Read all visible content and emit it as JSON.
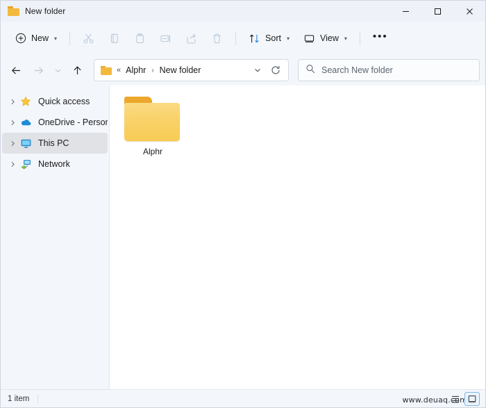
{
  "window": {
    "title": "New folder",
    "title_icon": "folder-icon",
    "controls": {
      "minimize": "minimize-icon",
      "maximize": "maximize-icon",
      "close": "close-icon"
    }
  },
  "toolbar": {
    "new_label": "New",
    "new_icon": "plus-circle-icon",
    "items": [
      {
        "name": "cut",
        "icon": "scissors-icon",
        "disabled": true
      },
      {
        "name": "copy",
        "icon": "copy-icon",
        "disabled": true
      },
      {
        "name": "paste",
        "icon": "clipboard-icon",
        "disabled": true
      },
      {
        "name": "rename",
        "icon": "rename-icon",
        "disabled": true
      },
      {
        "name": "share",
        "icon": "share-icon",
        "disabled": true
      },
      {
        "name": "delete",
        "icon": "trash-icon",
        "disabled": true
      }
    ],
    "sort_label": "Sort",
    "sort_icon": "sort-arrows-icon",
    "view_label": "View",
    "view_icon": "monitor-icon",
    "overflow_label": "•••"
  },
  "nav": {
    "back_icon": "arrow-left-icon",
    "forward_icon": "arrow-right-icon",
    "recent_icon": "chevron-down-icon",
    "up_icon": "arrow-up-icon",
    "address": {
      "folder_icon": "folder-icon",
      "overflow": "«",
      "crumbs": [
        "Alphr",
        "New folder"
      ],
      "separator": "›",
      "caret": "⌄",
      "refresh_icon": "refresh-icon"
    },
    "search": {
      "icon": "search-icon",
      "placeholder": "Search New folder",
      "value": ""
    }
  },
  "sidebar": {
    "items": [
      {
        "label": "Quick access",
        "icon": "star-icon",
        "selected": false
      },
      {
        "label": "OneDrive - Personal",
        "icon": "cloud-icon",
        "selected": false
      },
      {
        "label": "This PC",
        "icon": "monitor-icon",
        "selected": true
      },
      {
        "label": "Network",
        "icon": "network-icon",
        "selected": false
      }
    ]
  },
  "content": {
    "files": [
      {
        "name": "Alphr",
        "type": "folder",
        "icon": "folder-icon"
      }
    ]
  },
  "status": {
    "item_count": "1 item",
    "view_details_icon": "details-view-icon",
    "view_large_icons_icon": "large-icons-view-icon",
    "active_view": "large-icons-view-icon"
  },
  "watermark": {
    "text": "www.deuaq.com"
  },
  "colors": {
    "accent": "#0f6cbd",
    "folder": "#f8cb54",
    "folder_tab": "#eca72c",
    "chrome": "#f3f6fb",
    "selection": "#e0e2e6"
  }
}
